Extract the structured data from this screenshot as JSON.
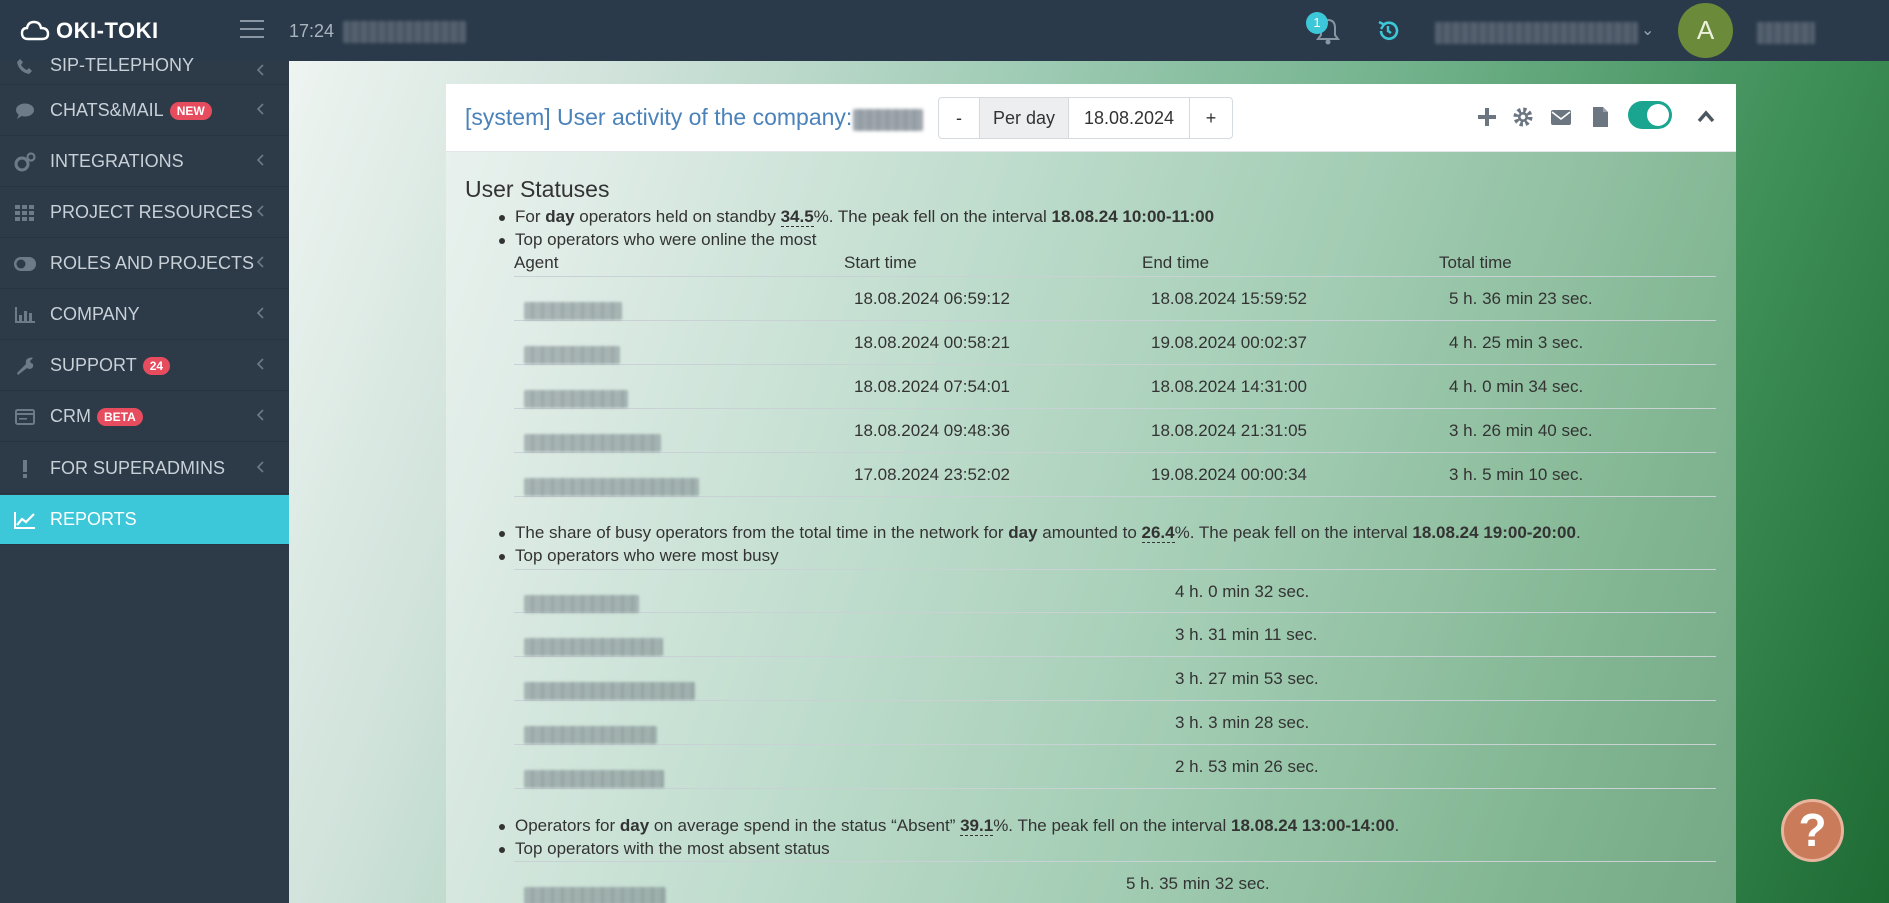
{
  "app": {
    "name": "OKI-TOKI",
    "time": "17:24"
  },
  "header": {
    "notification_count": "1",
    "avatar_letter": "A"
  },
  "sidebar": {
    "items": [
      {
        "label": "SIP-TELEPHONY",
        "icon": "phone-icon"
      },
      {
        "label": "CHATS&MAIL",
        "badge": "NEW",
        "icon": "chat-icon"
      },
      {
        "label": "INTEGRATIONS",
        "icon": "gears-icon"
      },
      {
        "label": "PROJECT RESOURCES",
        "icon": "grid-icon"
      },
      {
        "label": "ROLES AND PROJECTS",
        "icon": "toggle-icon"
      },
      {
        "label": "COMPANY",
        "icon": "bar-chart-icon"
      },
      {
        "label": "SUPPORT",
        "badge": "24",
        "icon": "wrench-icon"
      },
      {
        "label": "CRM",
        "badge": "BETA",
        "icon": "card-icon"
      },
      {
        "label": "FOR SUPERADMINS",
        "icon": "exclamation-icon"
      },
      {
        "label": "REPORTS",
        "icon": "line-chart-icon",
        "active": true
      }
    ]
  },
  "panel": {
    "title": "[system] User activity of the company:",
    "controls": {
      "minus": "-",
      "period": "Per day",
      "date": "18.08.2024",
      "plus": "+"
    }
  },
  "section": {
    "title": "User Statuses",
    "standby": {
      "pre": "For ",
      "period": "day",
      "mid": " operators held on standby ",
      "pct": "34.5",
      "post": "%. The peak fell on the interval ",
      "interval": "18.08.24 10:00-11:00"
    },
    "online_heading": "Top operators who were online the most",
    "online_columns": [
      "Agent",
      "Start time",
      "End time",
      "Total time"
    ],
    "online_rows": [
      {
        "agent_hint": "Bolkon Ersayl",
        "start": "18.08.2024 06:59:12",
        "end": "18.08.2024 15:59:52",
        "total": "5 h. 36 min 23 sec."
      },
      {
        "agent_hint": "",
        "start": "18.08.2024 00:58:21",
        "end": "19.08.2024 00:02:37",
        "total": "4 h. 25 min 3 sec."
      },
      {
        "agent_hint": "",
        "start": "18.08.2024 07:54:01",
        "end": "18.08.2024 14:31:00",
        "total": "4 h. 0 min 34 sec."
      },
      {
        "agent_hint": "",
        "start": "18.08.2024 09:48:36",
        "end": "18.08.2024 21:31:05",
        "total": "3 h. 26 min 40 sec."
      },
      {
        "agent_hint": "May Moses be blessed",
        "start": "17.08.2024 23:52:02",
        "end": "19.08.2024 00:00:34",
        "total": "3 h. 5 min 10 sec."
      }
    ],
    "busy": {
      "pre": "The share of busy operators from the total time in the network for ",
      "period": "day",
      "mid": " amounted to ",
      "pct": "26.4",
      "post": "%. The peak fell on the interval ",
      "interval": "18.08.24 19:00-20:00",
      "end": "."
    },
    "busy_heading": "Top operators who were most busy",
    "busy_rows": [
      {
        "total": "4 h. 0 min 32 sec."
      },
      {
        "total": "3 h. 31 min 11 sec."
      },
      {
        "total": "3 h. 27 min 53 sec."
      },
      {
        "total": "3 h. 3 min 28 sec."
      },
      {
        "total": "2 h. 53 min 26 sec."
      }
    ],
    "absent": {
      "pre": "Operators for ",
      "period": "day",
      "mid": " on average spend in the status “Absent” ",
      "pct": "39.1",
      "post": "%. The peak fell on the interval ",
      "interval": "18.08.24 13:00-14:00",
      "end": "."
    },
    "absent_heading": "Top operators with the most absent status",
    "absent_rows": [
      {
        "agent_hint": "Rakyt Nusdena",
        "total": "5 h. 35 min 32 sec."
      }
    ]
  },
  "help": {
    "label": "?"
  }
}
